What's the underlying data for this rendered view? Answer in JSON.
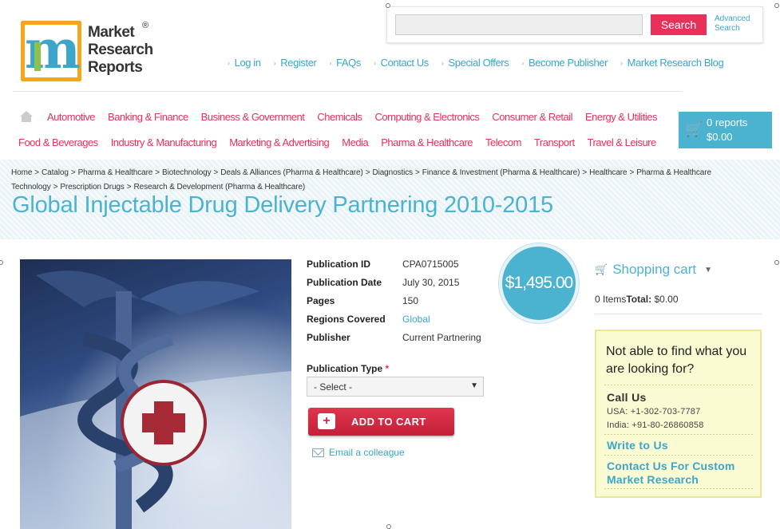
{
  "logo": {
    "line1": "Market",
    "line2": "Research",
    "line3": "Reports",
    "reg": "®",
    "letter": "m"
  },
  "search": {
    "placeholder": "",
    "button_label": "Search",
    "advanced_line1": "Advanced",
    "advanced_line2": "Search"
  },
  "top_links": [
    "Log in",
    "Register",
    "FAQs",
    "Contact Us",
    "Special Offers",
    "Become Publisher",
    "Market Research Blog"
  ],
  "categories_row1": [
    "Automotive",
    "Banking & Finance",
    "Business & Government",
    "Chemicals",
    "Computing & Electronics",
    "Consumer & Retail",
    "Energy & Utilities"
  ],
  "categories_row2": [
    "Food & Beverages",
    "Industry & Manufacturing",
    "Marketing & Advertising",
    "Media",
    "Pharma & Healthcare",
    "Telecom",
    "Transport",
    "Travel & Leisure"
  ],
  "cart_button": {
    "reports": "0 reports",
    "amount": "$0.00"
  },
  "breadcrumb": [
    "Home",
    "Catalog",
    "Pharma & Healthcare",
    "Biotechnology",
    "Deals & Alliances (Pharma & Healthcare)",
    "Diagnostics",
    "Finance & Investment (Pharma & Healthcare)",
    "Healthcare",
    "Pharma & Healthcare Technology",
    "Prescription Drugs",
    "Research & Development (Pharma & Healthcare)"
  ],
  "page_title": "Global Injectable Drug Delivery Partnering 2010-2015",
  "details": {
    "pub_id_label": "Publication ID",
    "pub_id": "CPA0715005",
    "pub_date_label": "Publication Date",
    "pub_date": "July 30, 2015",
    "pages_label": "Pages",
    "pages": "150",
    "regions_label": "Regions Covered",
    "regions": "Global",
    "publisher_label": "Publisher",
    "publisher": "Current Partnering"
  },
  "price": "$1,495.00",
  "publication_type": {
    "label": "Publication Type",
    "required_mark": "*",
    "selected": "- Select -"
  },
  "add_to_cart": "ADD TO CART",
  "email_colleague": "Email a colleague",
  "shopping_cart": {
    "title": "Shopping cart",
    "items": "0 Items",
    "total_label": "Total:",
    "total_value": "$0.00"
  },
  "help": {
    "title": "Not able to find what you are looking for?",
    "call_us": "Call Us",
    "phone_usa": "USA: +1-302-703-7787",
    "phone_india": "India: +91-80-26860858",
    "write_us": "Write to Us",
    "custom_research": "Contact Us For Custom Market Research"
  },
  "colors": {
    "accent_blue": "#4bb3d0",
    "accent_pink": "#e8305b",
    "logo_orange": "#f7a51c"
  }
}
